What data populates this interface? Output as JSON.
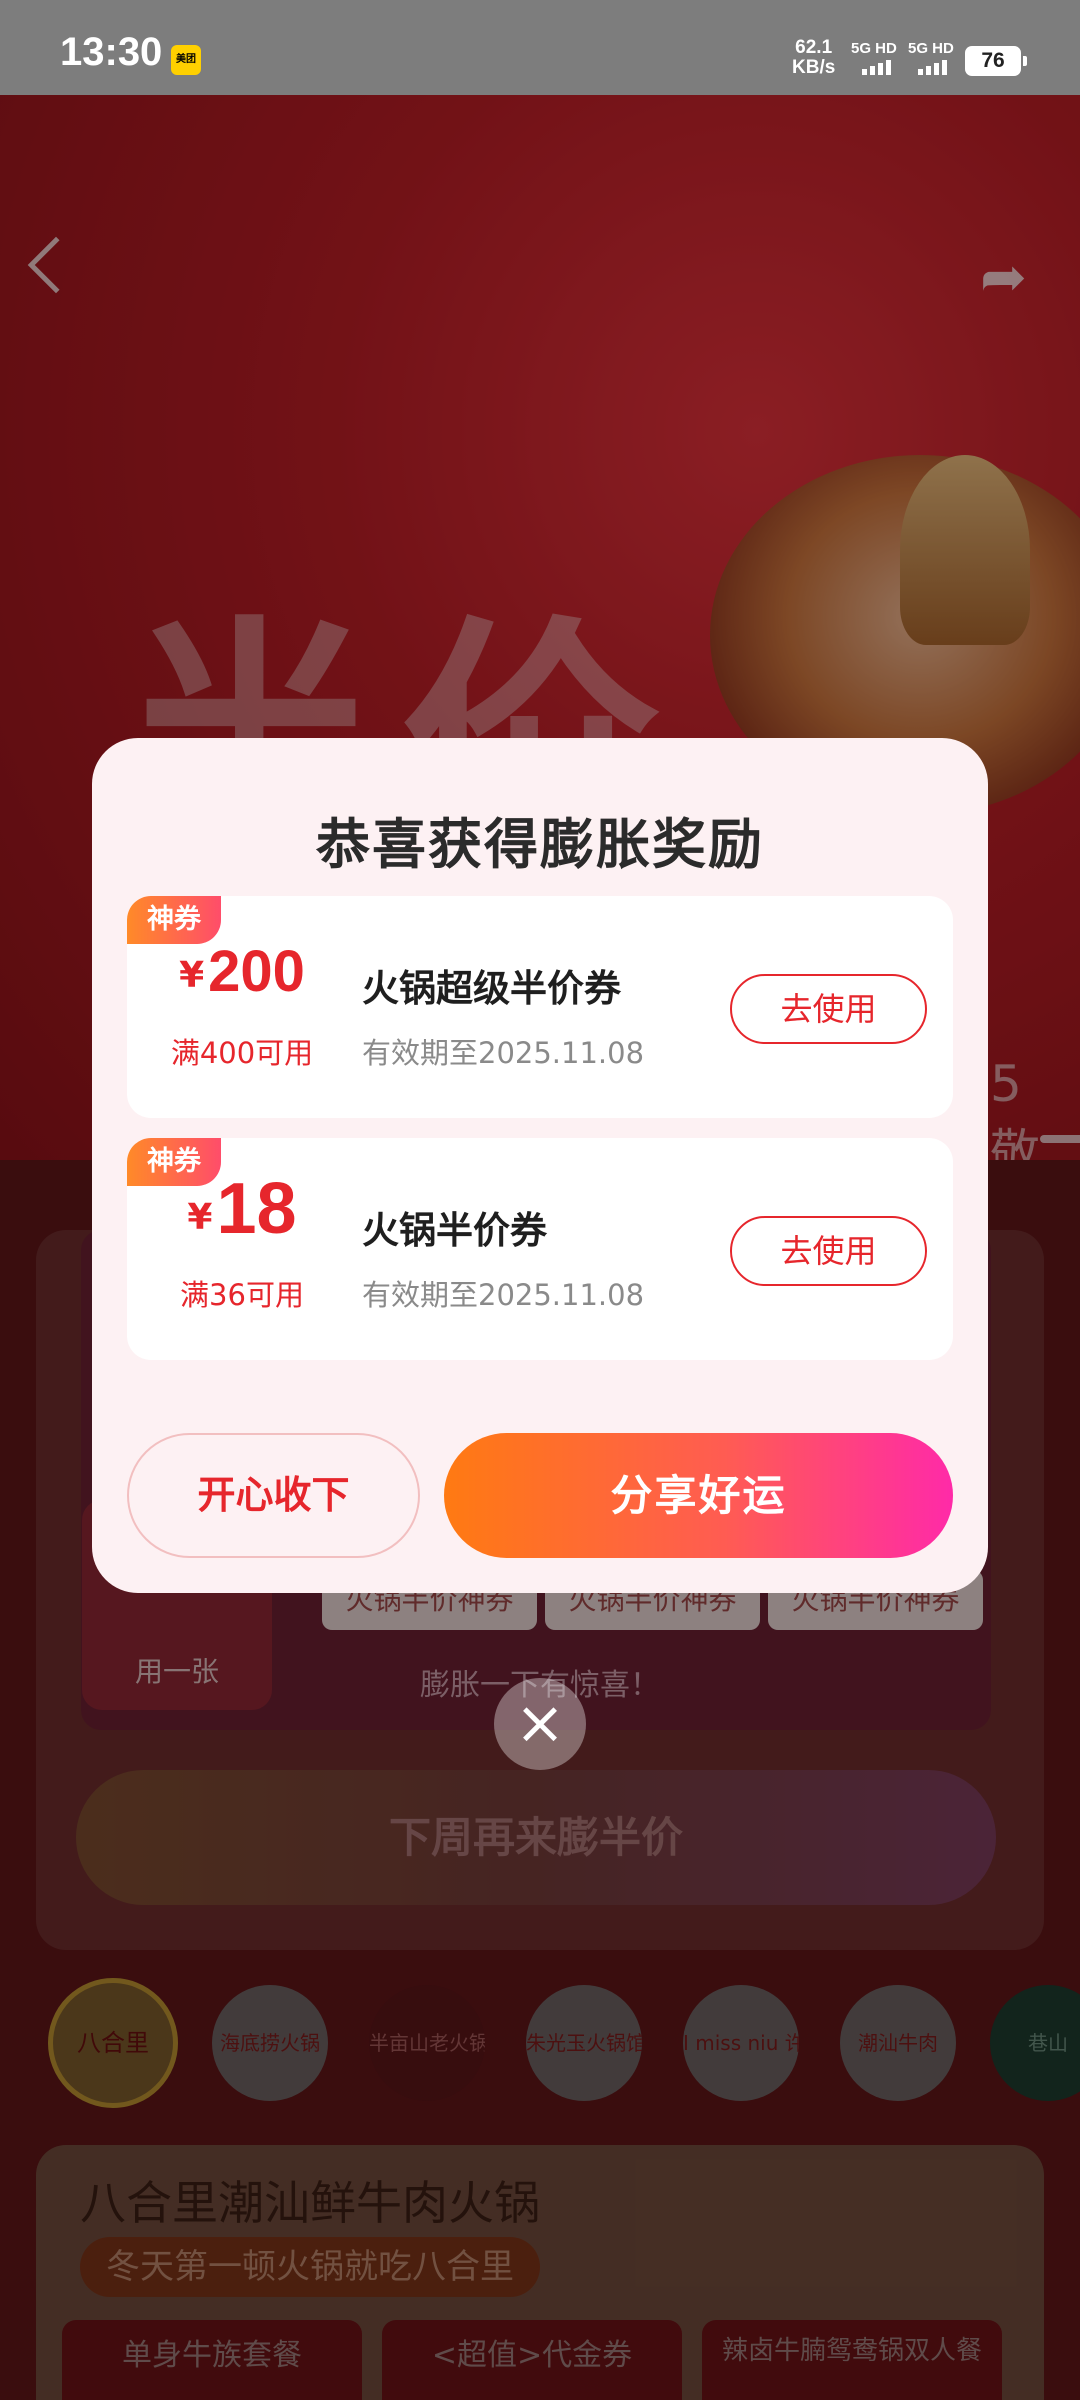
{
  "status_bar": {
    "time": "13:30",
    "app_badge": "美团",
    "speed_value": "62.1",
    "speed_unit": "KB/s",
    "sim1": "5G HD",
    "sim2": "5G HD",
    "battery": "76"
  },
  "background": {
    "hero_title": "半价",
    "side_text": "5 敬",
    "use_one_label": "用一张",
    "slot_labels": [
      "火锅半价神券",
      "火锅半价神券",
      "火锅半价神券"
    ],
    "hint": "膨胀一下有惊喜！",
    "next_week_button": "下周再来膨半价",
    "brands": [
      "八合里",
      "海底捞火锅",
      "半亩山老火锅",
      "朱光玉火锅馆",
      "I miss niu 许府牛",
      "潮汕牛肉",
      "巷山"
    ],
    "promo_title": "八合里潮汕鲜牛肉火锅",
    "promo_subtitle": "冬天第一顿火锅就吃八合里",
    "promo_tiles": [
      "单身牛族套餐",
      "<超值>代金券",
      "辣卤牛腩鸳鸯锅双人餐"
    ]
  },
  "dialog": {
    "title": "恭喜获得膨胀奖励",
    "coupons": [
      {
        "tag": "神券",
        "currency": "¥",
        "amount": "200",
        "condition": "满400可用",
        "name": "火锅超级半价券",
        "validity": "有效期至2025.11.08",
        "button": "去使用"
      },
      {
        "tag": "神券",
        "currency": "¥",
        "amount": "18",
        "condition": "满36可用",
        "name": "火锅半价券",
        "validity": "有效期至2025.11.08",
        "button": "去使用"
      }
    ],
    "accept_button": "开心收下",
    "share_button": "分享好运",
    "close_icon": "close-icon"
  }
}
